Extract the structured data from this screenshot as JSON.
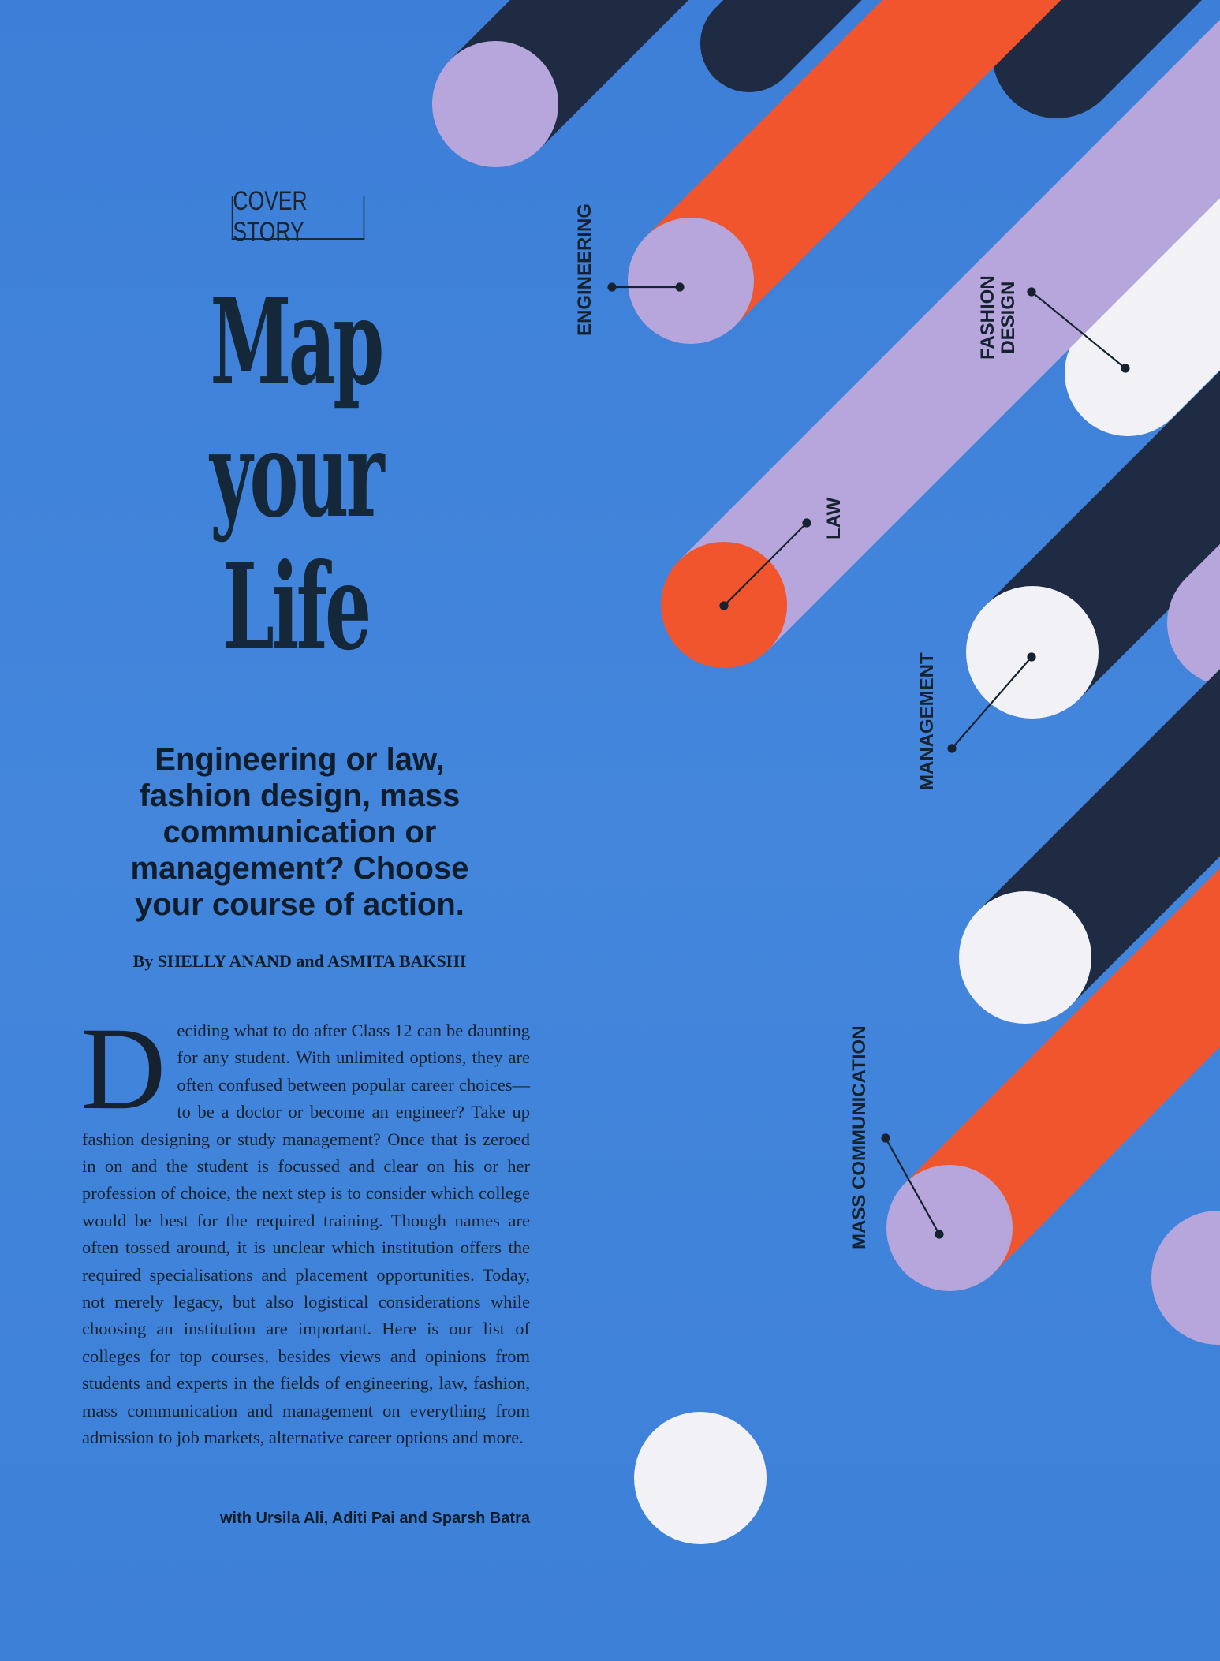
{
  "kicker": "COVER STORY",
  "headline": {
    "line1": "Map",
    "line2": "your",
    "line3": "Life"
  },
  "dek": "Engineering or law, fashion design, mass communication or management? Choose your course of action.",
  "byline": "By SHELLY ANAND and ASMITA BAKSHI",
  "body": {
    "dropcap": "D",
    "text": "eciding what to do after Class 12 can be daunting for any student. With unlimited options, they are often confused between popular career choices—to be a doctor or become an engineer? Take up fashion designing or study management? Once that is zeroed in on and the student is focussed and clear on his or her profession of choice, the next step is to consider which college would be best for the required training. Though names are often tossed around, it is unclear which institution offers the required specialisations and placement opportunities. Today, not merely legacy, but also logistical considerations while choosing an institution are important. Here is our list of colleges for top courses, besides views and opinions from students and experts in the fields of engineering, law, fashion, mass communication and management on everything from admission to job markets, alternative career options and more."
  },
  "credit": "with Ursila Ali, Aditi Pai and Sparsh Batra",
  "labels": {
    "engineering": "ENGINEERING",
    "fashion_line1": "FASHION",
    "fashion_line2": "DESIGN",
    "law": "LAW",
    "management": "MANAGEMENT",
    "mass_communication": "MASS COMMUNICATION"
  },
  "colors": {
    "background": "#3f82d9",
    "navy": "#1f2b42",
    "orange": "#f0552e",
    "lilac": "#b6a6dc",
    "white": "#f2f2f6",
    "text": "#14283a"
  }
}
